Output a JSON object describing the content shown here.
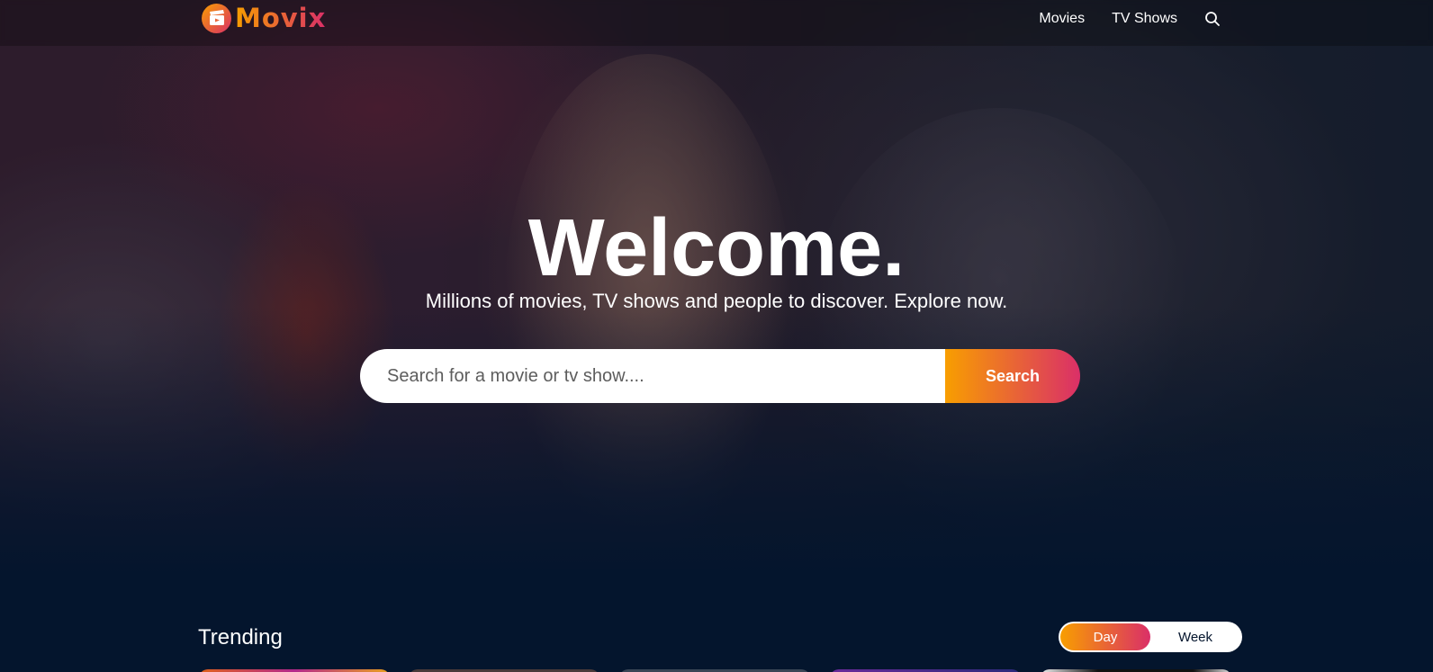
{
  "header": {
    "logo_text": "Movix",
    "nav": {
      "movies": "Movies",
      "tv_shows": "TV Shows"
    }
  },
  "hero": {
    "title": "Welcome.",
    "subtitle": "Millions of movies, TV shows and people to discover. Explore now.",
    "search": {
      "placeholder": "Search for a movie or tv show....",
      "value": "",
      "button_label": "Search"
    }
  },
  "trending": {
    "title": "Trending",
    "tabs": [
      {
        "label": "Day",
        "active": true
      },
      {
        "label": "Week",
        "active": false
      }
    ]
  },
  "colors": {
    "background": "#04152d",
    "accent_start": "#f89e00",
    "accent_end": "#da2f68"
  },
  "icons": {
    "logo": "clapperboard-icon",
    "search": "search-icon"
  }
}
